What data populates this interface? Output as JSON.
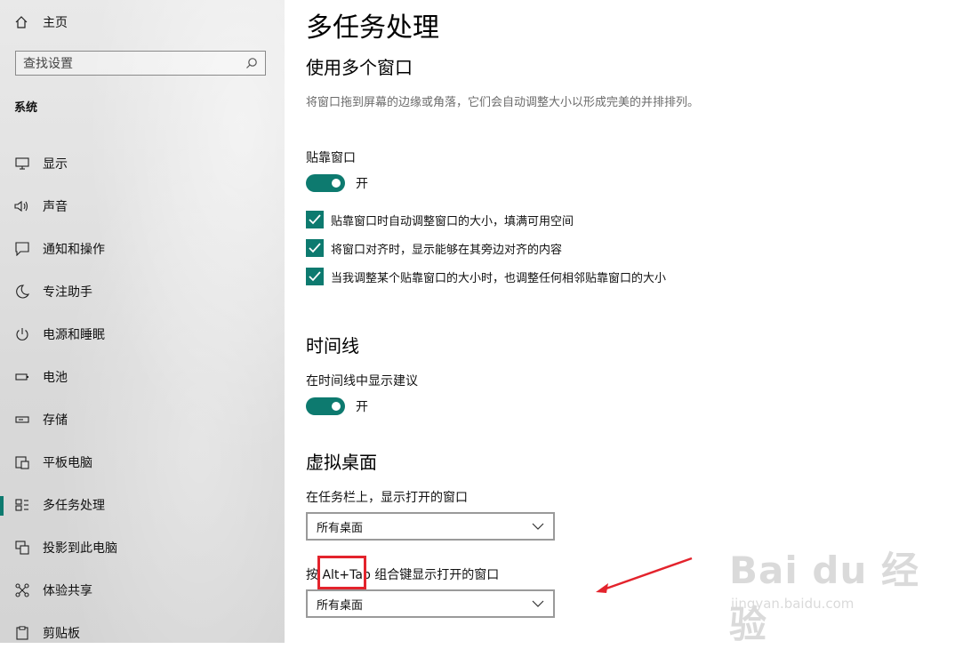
{
  "sidebar": {
    "home_label": "主页",
    "search_placeholder": "查找设置",
    "section": "系统",
    "items": [
      {
        "label": "显示",
        "icon": "monitor-icon"
      },
      {
        "label": "声音",
        "icon": "speaker-icon"
      },
      {
        "label": "通知和操作",
        "icon": "notification-icon"
      },
      {
        "label": "专注助手",
        "icon": "moon-icon"
      },
      {
        "label": "电源和睡眠",
        "icon": "power-icon"
      },
      {
        "label": "电池",
        "icon": "battery-icon"
      },
      {
        "label": "存储",
        "icon": "storage-icon"
      },
      {
        "label": "平板电脑",
        "icon": "tablet-icon"
      },
      {
        "label": "多任务处理",
        "icon": "multitask-icon",
        "active": true
      },
      {
        "label": "投影到此电脑",
        "icon": "project-icon"
      },
      {
        "label": "体验共享",
        "icon": "share-icon"
      },
      {
        "label": "剪贴板",
        "icon": "clipboard-icon"
      }
    ]
  },
  "main": {
    "title": "多任务处理",
    "snap": {
      "heading": "使用多个窗口",
      "description": "将窗口拖到屏幕的边缘或角落，它们会自动调整大小以形成完美的并排排列。",
      "toggle_label": "贴靠窗口",
      "toggle_state": "开",
      "options": [
        "贴靠窗口时自动调整窗口的大小，填满可用空间",
        "将窗口对齐时，显示能够在其旁边对齐的内容",
        "当我调整某个贴靠窗口的大小时，也调整任何相邻贴靠窗口的大小"
      ]
    },
    "timeline": {
      "heading": "时间线",
      "toggle_label": "在时间线中显示建议",
      "toggle_state": "开"
    },
    "virtual_desktops": {
      "heading": "虚拟桌面",
      "taskbar_label": "在任务栏上，显示打开的窗口",
      "taskbar_value": "所有桌面",
      "alttab_prefix": "按",
      "alttab_key": "Alt+Tab",
      "alttab_suffix": "组合键显示打开的窗口",
      "alttab_value": "所有桌面"
    }
  },
  "watermark": {
    "logo": "Bai du 经验",
    "url": "jingyan.baidu.com"
  },
  "colors": {
    "accent": "#0d7a6f",
    "annotation": "#e3232c"
  }
}
